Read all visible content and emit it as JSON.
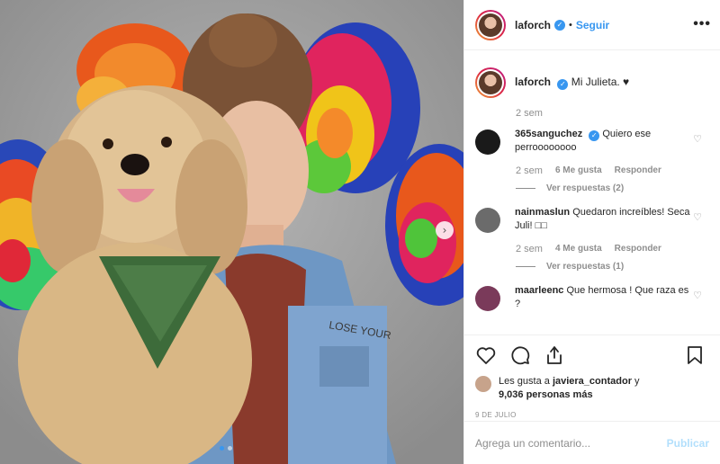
{
  "post": {
    "username": "laforch",
    "follow_label": "Seguir",
    "separator": "•",
    "more_label": "•••",
    "verified_glyph": "✓",
    "photo_text": "LOSE YOUR",
    "next_glyph": "›"
  },
  "caption": {
    "username": "laforch",
    "text": "Mi Julieta. ♥",
    "time": "2 sem"
  },
  "comments": [
    {
      "username": "365sanguchez",
      "text": "Quiero ese perroooooooo",
      "verified": true,
      "time": "2 sem",
      "likes": "6 Me gusta",
      "reply_label": "Responder",
      "view_replies": "Ver respuestas (2)",
      "avatar_color": "#1a1a1a"
    },
    {
      "username": "nainmaslun",
      "text": "Quedaron increíbles! Seca Juli! □□",
      "verified": false,
      "time": "2 sem",
      "likes": "4 Me gusta",
      "reply_label": "Responder",
      "view_replies": "Ver respuestas (1)",
      "avatar_color": "#6b6b6b"
    },
    {
      "username": "maarleenc",
      "text": "Que hermosa ! Que raza es ?",
      "verified": false,
      "avatar_color": "#7a3a5a"
    }
  ],
  "heart_glyph": "♡",
  "likes": {
    "prefix": "Les gusta a",
    "user": "javiera_contador",
    "suffix": "y",
    "others": "9,036 personas más"
  },
  "date": "9 DE JULIO",
  "comment_input": {
    "placeholder": "Agrega un comentario...",
    "submit_label": "Publicar"
  },
  "colors": {
    "accent": "#3897f0",
    "publish_disabled": "#b2dffc",
    "muted": "#8e8e8e",
    "text": "#262626",
    "photo_background": "#9a9a9a"
  },
  "icons": {
    "like": "heart-icon",
    "comment": "comment-bubble-icon",
    "share": "share-icon",
    "save": "bookmark-icon",
    "more": "more-options-icon",
    "next": "chevron-right-icon"
  }
}
